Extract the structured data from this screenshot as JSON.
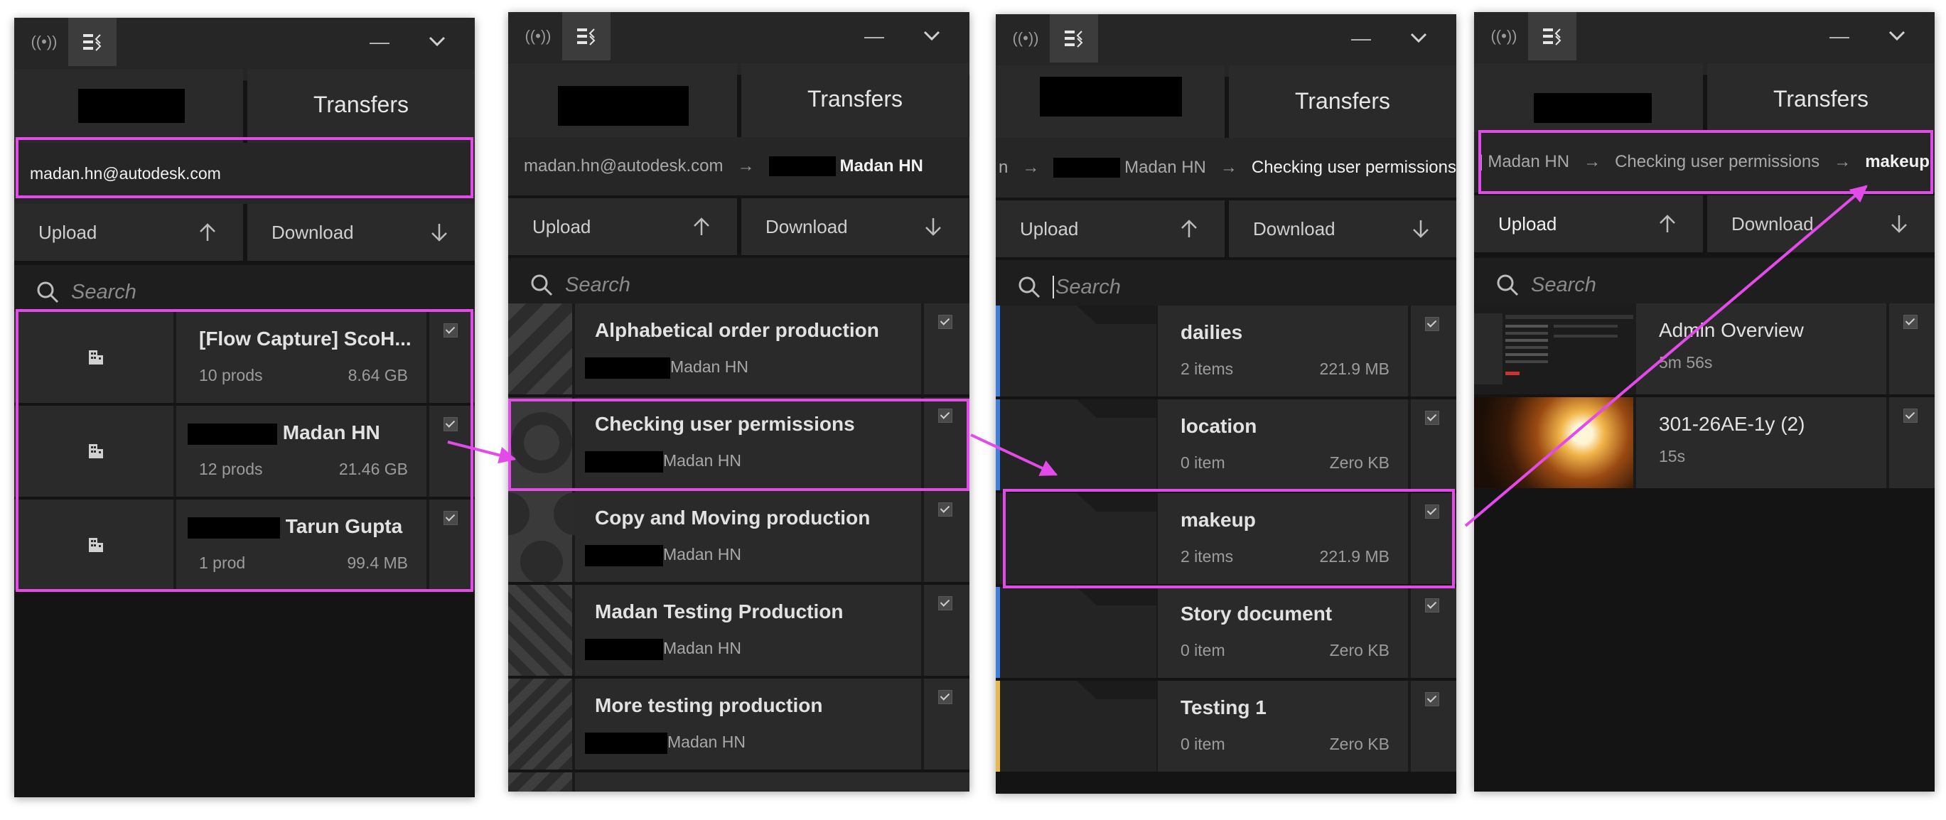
{
  "colors": {
    "highlight": "#e24be8",
    "panel_bg": "#141414",
    "row_bg": "#2a2a2a",
    "stripe_blue": "#3f7fe0",
    "stripe_yellow": "#e8b84a"
  },
  "common": {
    "transfers_label": "Transfers",
    "upload_label": "Upload",
    "download_label": "Download",
    "search_placeholder": "Search",
    "minimize_glyph": "—"
  },
  "panel1": {
    "account": "madan.hn@autodesk.com",
    "rows": [
      {
        "title": "[Flow Capture] ScoH...",
        "sub": "10 prods",
        "size": "8.64 GB",
        "icon": "building-icon"
      },
      {
        "title": "Madan HN",
        "sub": "12 prods",
        "size": "21.46 GB",
        "icon": "building-icon"
      },
      {
        "title": "Tarun Gupta",
        "sub": "1 prod",
        "size": "99.4 MB",
        "icon": "building-icon"
      }
    ]
  },
  "panel2": {
    "crumbs": [
      "madan.hn@autodesk.com",
      "Madan HN"
    ],
    "rows": [
      {
        "title": "Alphabetical order production",
        "sub": "Madan HN"
      },
      {
        "title": "Checking user permissions",
        "sub": "Madan HN"
      },
      {
        "title": "Copy and Moving production",
        "sub": "Madan HN"
      },
      {
        "title": "Madan Testing Production",
        "sub": "Madan HN"
      },
      {
        "title": "More testing production",
        "sub": "Madan HN"
      }
    ]
  },
  "panel3": {
    "crumbs": [
      "n",
      "Madan HN",
      "Checking user permissions"
    ],
    "rows": [
      {
        "title": "dailies",
        "sub": "2 items",
        "size": "221.9 MB",
        "stripe": "blue"
      },
      {
        "title": "location",
        "sub": "0 item",
        "size": "Zero KB",
        "stripe": "blue"
      },
      {
        "title": "makeup",
        "sub": "2 items",
        "size": "221.9 MB",
        "stripe": "none"
      },
      {
        "title": "Story document",
        "sub": "0 item",
        "size": "Zero KB",
        "stripe": "blue"
      },
      {
        "title": "Testing 1",
        "sub": "0 item",
        "size": "Zero KB",
        "stripe": "yellow"
      }
    ]
  },
  "panel4": {
    "crumbs": [
      "] Madan HN",
      "Checking user permissions",
      "makeup"
    ],
    "rows": [
      {
        "title": "Admin Overview",
        "sub": "5m 56s"
      },
      {
        "title": "301-26AE-1y (2)",
        "sub": "15s"
      }
    ]
  }
}
